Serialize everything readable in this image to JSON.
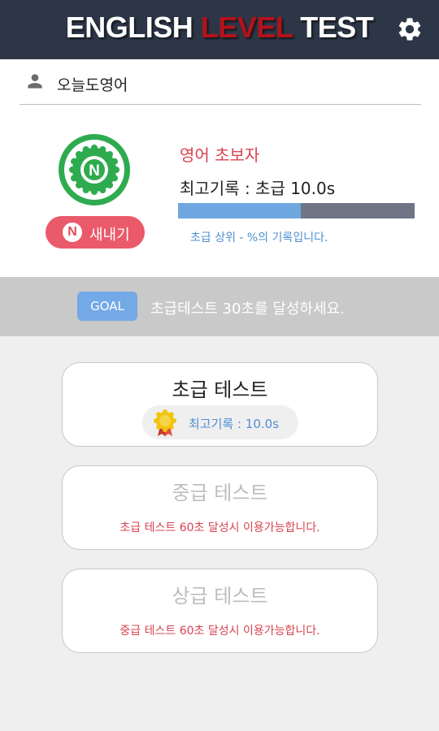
{
  "header": {
    "title_part1": "ENGLISH",
    "title_part2": "LEVEL",
    "title_part3": "TEST",
    "settings_icon": "gear-icon",
    "colors": {
      "bar": "#2c3646",
      "accent": "#b3121b"
    }
  },
  "profile": {
    "user_icon": "person-icon",
    "username": "오늘도영어",
    "badge_icon": "n-badge-icon",
    "badge_letter": "N",
    "new_button": {
      "letter": "N",
      "label": "새내기"
    },
    "level_title": "영어 초보자",
    "best_record": "최고기록 : 초급 10.0s",
    "progress_fraction": 0.52,
    "rank_text": "초급 상위 - %의 기록입니다."
  },
  "goal": {
    "badge_label": "GOAL",
    "text": "초급테스트 30초를 달성하세요."
  },
  "tests": [
    {
      "title": "초급 테스트",
      "record_icon": "medal-icon",
      "record": "최고기록 : 10.0s",
      "enabled": true
    },
    {
      "title": "중급 테스트",
      "subtitle": "초급 테스트 60초 달성시 이용가능합니다.",
      "enabled": false
    },
    {
      "title": "상급 테스트",
      "subtitle": "중급 테스트 60초 달성시 이용가능합니다.",
      "enabled": false
    }
  ]
}
